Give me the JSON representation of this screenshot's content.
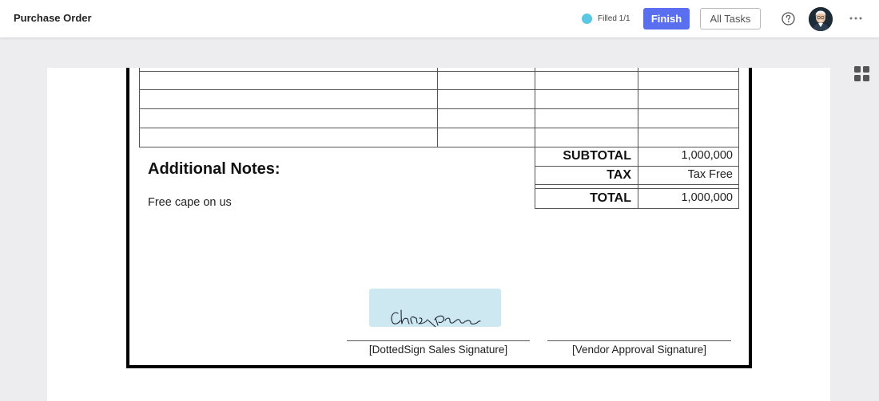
{
  "header": {
    "title": "Purchase Order",
    "status_text": "Filled 1/1",
    "status_color": "#5cc7e0",
    "finish_label": "Finish",
    "all_tasks_label": "All Tasks",
    "help_icon": "help-circle-icon",
    "more_icon": "more-horizontal-icon",
    "accent_color": "#5a6ff0"
  },
  "sidebar": {
    "view_toggle_icon": "grid-view-icon"
  },
  "document": {
    "totals": {
      "subtotal_label": "SUBTOTAL",
      "subtotal_value": "1,000,000",
      "tax_label": "TAX",
      "tax_value": "Tax Free",
      "total_label": "TOTAL",
      "total_value": "1,000,000"
    },
    "notes_heading": "Additional Notes:",
    "notes_text": "Free cape on us",
    "signatures": {
      "sales_label": "[DottedSign Sales Signature]",
      "vendor_label": "[Vendor Approval Signature]",
      "sales_signature_field_color": "#cde8f0"
    }
  }
}
